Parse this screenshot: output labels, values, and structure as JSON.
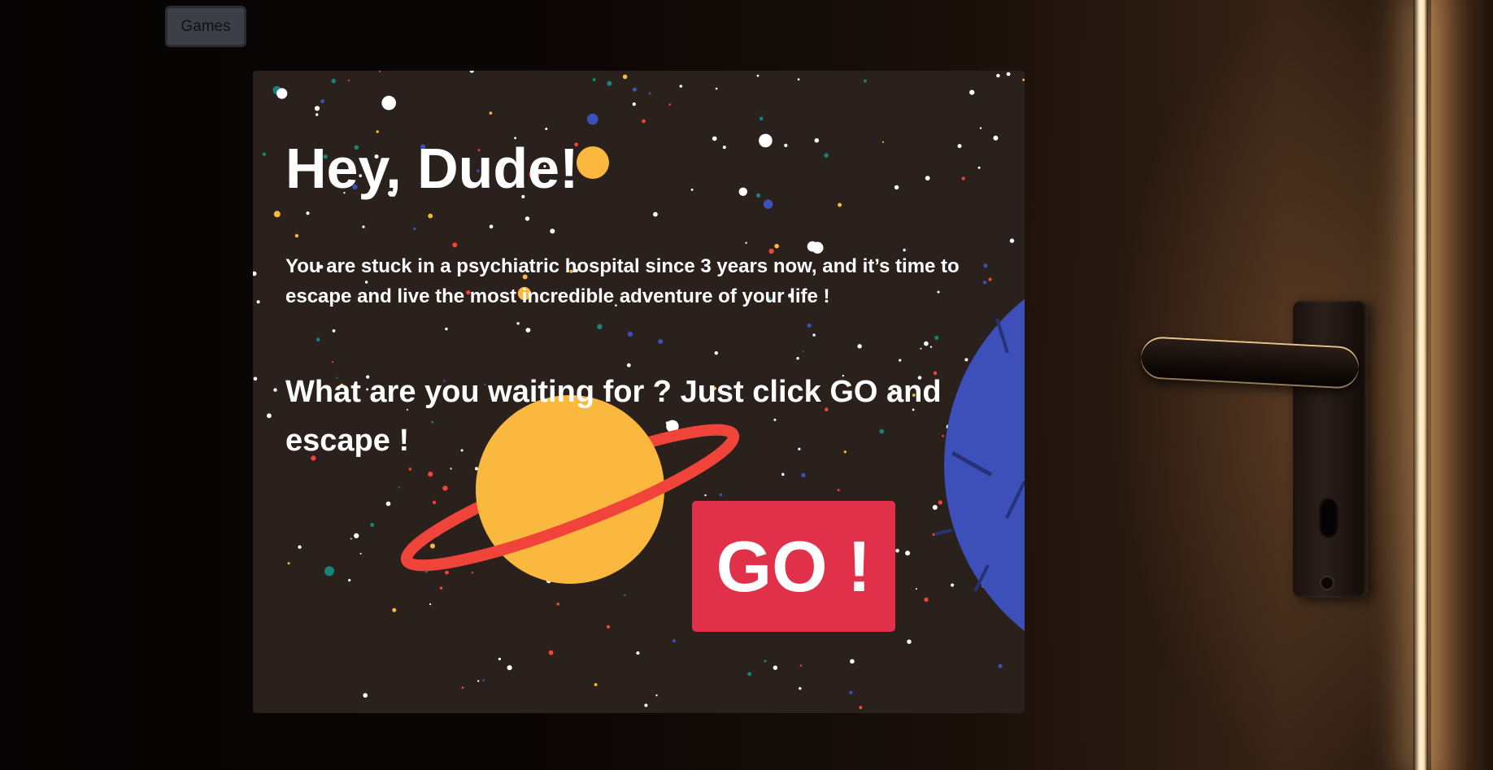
{
  "nav": {
    "games_label": "Games"
  },
  "intro_card": {
    "title": "Hey, Dude!",
    "story": "You are stuck in a psychiatric hospital since 3 years now, and it’s time to escape and live the most incredible adventure of your life !",
    "call_to_action": "What are you waiting for ? Just click GO and escape !",
    "go_label": "GO !"
  },
  "colors": {
    "card_background": "#2a211c",
    "go_button": "#e0304a",
    "planet_yellow": "#fbb83e",
    "planet_ring": "#f0443b",
    "planet_blue": "#3d4fb9"
  }
}
